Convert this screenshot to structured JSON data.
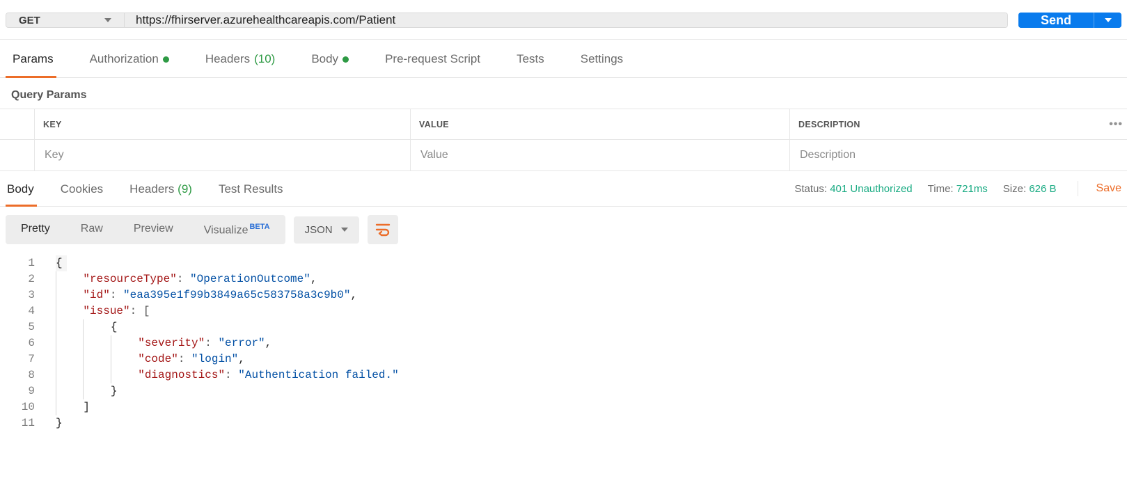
{
  "request": {
    "method": "GET",
    "url": "https://fhirserver.azurehealthcareapis.com/Patient",
    "send_label": "Send"
  },
  "request_tabs": {
    "params": "Params",
    "authorization": "Authorization",
    "headers": "Headers",
    "headers_count": "(10)",
    "body": "Body",
    "prerequest": "Pre-request Script",
    "tests": "Tests",
    "settings": "Settings"
  },
  "query_params": {
    "title": "Query Params",
    "headers": {
      "key": "KEY",
      "value": "VALUE",
      "description": "DESCRIPTION"
    },
    "placeholders": {
      "key": "Key",
      "value": "Value",
      "description": "Description"
    }
  },
  "response_tabs": {
    "body": "Body",
    "cookies": "Cookies",
    "headers": "Headers",
    "headers_count": "(9)",
    "test_results": "Test Results"
  },
  "response_meta": {
    "status_label": "Status:",
    "status_value": "401 Unauthorized",
    "time_label": "Time:",
    "time_value": "721ms",
    "size_label": "Size:",
    "size_value": "626 B",
    "save": "Save"
  },
  "body_toolbar": {
    "pretty": "Pretty",
    "raw": "Raw",
    "preview": "Preview",
    "visualize": "Visualize",
    "beta": "BETA",
    "format": "JSON"
  },
  "response_body": {
    "resourceType": "OperationOutcome",
    "id": "eaa395e1f99b3849a65c583758a3c9b0",
    "issue": [
      {
        "severity": "error",
        "code": "login",
        "diagnostics": "Authentication failed."
      }
    ]
  },
  "code_lines": [
    "{",
    "    \"resourceType\": \"OperationOutcome\",",
    "    \"id\": \"eaa395e1f99b3849a65c583758a3c9b0\",",
    "    \"issue\": [",
    "        {",
    "            \"severity\": \"error\",",
    "            \"code\": \"login\",",
    "            \"diagnostics\": \"Authentication failed.\"",
    "        }",
    "    ]",
    "}"
  ]
}
